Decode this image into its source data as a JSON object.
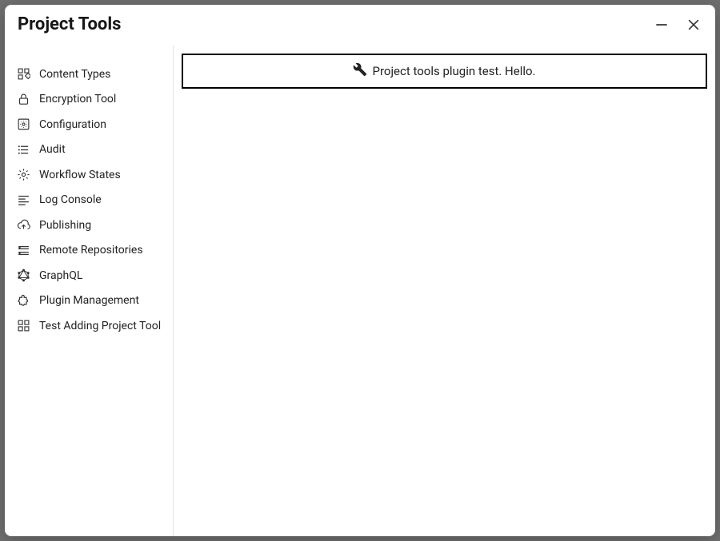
{
  "dialog": {
    "title": "Project Tools"
  },
  "sidebar": {
    "items": [
      {
        "label": "Content Types"
      },
      {
        "label": "Encryption Tool"
      },
      {
        "label": "Configuration"
      },
      {
        "label": "Audit"
      },
      {
        "label": "Workflow States"
      },
      {
        "label": "Log Console"
      },
      {
        "label": "Publishing"
      },
      {
        "label": "Remote Repositories"
      },
      {
        "label": "GraphQL"
      },
      {
        "label": "Plugin Management"
      },
      {
        "label": "Test Adding Project Tool"
      }
    ]
  },
  "main": {
    "banner_text": "Project tools plugin test. Hello."
  }
}
